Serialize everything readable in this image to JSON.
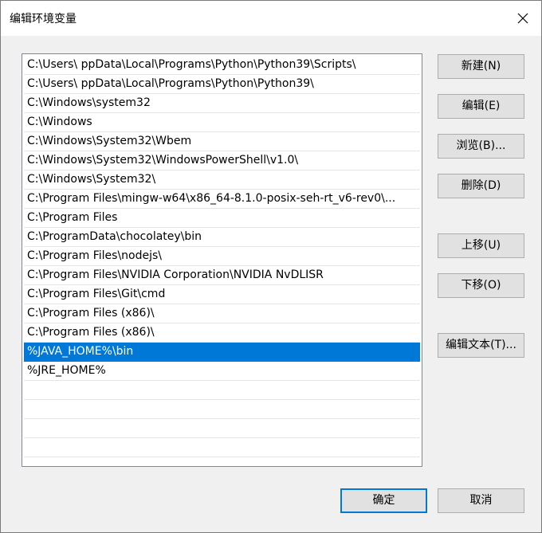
{
  "window": {
    "title": "编辑环境变量",
    "close_glyph": "close-icon"
  },
  "list": {
    "items": [
      {
        "text": "C:\\Users\\       ppData\\Local\\Programs\\Python\\Python39\\Scripts\\",
        "selected": false
      },
      {
        "text": "C:\\Users\\       ppData\\Local\\Programs\\Python\\Python39\\",
        "selected": false
      },
      {
        "text": "C:\\Windows\\system32",
        "selected": false
      },
      {
        "text": "C:\\Windows",
        "selected": false
      },
      {
        "text": "C:\\Windows\\System32\\Wbem",
        "selected": false
      },
      {
        "text": "C:\\Windows\\System32\\WindowsPowerShell\\v1.0\\",
        "selected": false
      },
      {
        "text": "C:\\Windows\\System32\\",
        "selected": false
      },
      {
        "text": "C:\\Program Files\\mingw-w64\\x86_64-8.1.0-posix-seh-rt_v6-rev0\\...",
        "selected": false
      },
      {
        "text": "C:\\Program Files",
        "selected": false
      },
      {
        "text": "C:\\ProgramData\\chocolatey\\bin",
        "selected": false
      },
      {
        "text": "C:\\Program Files\\nodejs\\",
        "selected": false
      },
      {
        "text": "C:\\Program Files\\NVIDIA Corporation\\NVIDIA NvDLISR",
        "selected": false
      },
      {
        "text": "C:\\Program Files\\Git\\cmd",
        "selected": false
      },
      {
        "text": "C:\\Program Files (x86)\\",
        "selected": false
      },
      {
        "text": "C:\\Program Files (x86)\\",
        "selected": false
      },
      {
        "text": "%JAVA_HOME%\\bin",
        "selected": true
      },
      {
        "text": "%JRE_HOME%",
        "selected": false
      }
    ],
    "empty_rows": 4
  },
  "buttons": {
    "new": "新建(N)",
    "edit": "编辑(E)",
    "browse": "浏览(B)...",
    "delete": "删除(D)",
    "move_up": "上移(U)",
    "move_down": "下移(O)",
    "edit_text": "编辑文本(T)...",
    "ok": "确定",
    "cancel": "取消"
  },
  "colors": {
    "selection": "#0078d7",
    "dialog_bg": "#f0f0f0",
    "button_bg": "#e1e1e1"
  }
}
